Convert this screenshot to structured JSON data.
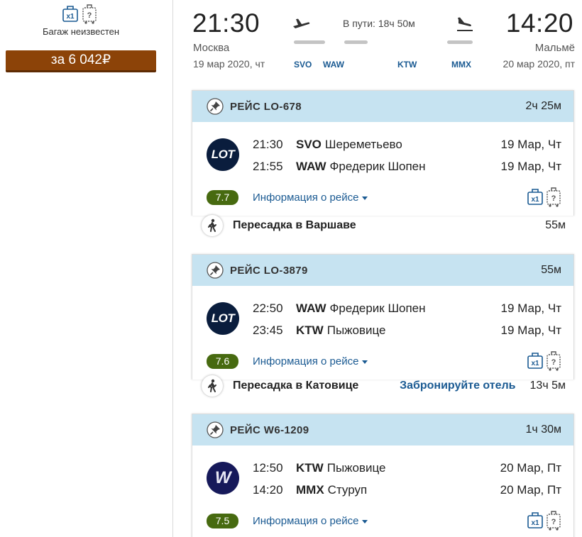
{
  "baggage": {
    "caption": "Багаж неизвестен",
    "hand_count": "x1",
    "checked_mark": "?"
  },
  "price": {
    "label": "за 6 042₽"
  },
  "summary": {
    "departure": {
      "time": "21:30",
      "city": "Москва",
      "date": "19 мар 2020, чт"
    },
    "arrival": {
      "time": "14:20",
      "city": "Мальмё",
      "date": "20 мар 2020, пт"
    },
    "duration": "В пути: 18ч 50м",
    "airports": [
      "SVO",
      "WAW",
      "KTW",
      "MMX"
    ]
  },
  "segments": [
    {
      "flight": "РЕЙС LO-678",
      "duration": "2ч 25м",
      "airline": "LOT",
      "rating": "7.7",
      "info_label": "Информация о рейсе",
      "dep": {
        "time": "21:30",
        "code": "SVO",
        "name": "Шереметьево",
        "date": "19 Мар, Чт"
      },
      "arr": {
        "time": "21:55",
        "code": "WAW",
        "name": "Фредерик Шопен",
        "date": "19 Мар, Чт"
      }
    },
    {
      "flight": "РЕЙС LO-3879",
      "duration": "55м",
      "airline": "LOT",
      "rating": "7.6",
      "info_label": "Информация о рейсе",
      "dep": {
        "time": "22:50",
        "code": "WAW",
        "name": "Фредерик Шопен",
        "date": "19 Мар, Чт"
      },
      "arr": {
        "time": "23:45",
        "code": "KTW",
        "name": "Пыжовице",
        "date": "19 Мар, Чт"
      }
    },
    {
      "flight": "РЕЙС W6-1209",
      "duration": "1ч 30м",
      "airline": "W",
      "rating": "7.5",
      "info_label": "Информация о рейсе",
      "dep": {
        "time": "12:50",
        "code": "KTW",
        "name": "Пыжовице",
        "date": "20 Мар, Пт"
      },
      "arr": {
        "time": "14:20",
        "code": "MMX",
        "name": "Стуруп",
        "date": "20 Мар, Пт"
      }
    }
  ],
  "transfers": [
    {
      "label": "Пересадка в Варшаве",
      "duration": "55м"
    },
    {
      "label": "Пересадка в Катовице",
      "hotel_link": "Забронируйте отель",
      "duration": "13ч 5м"
    }
  ],
  "colors": {
    "price_button": "#8c4308",
    "header_band": "#c6e3f1",
    "link": "#1a5a92",
    "rating": "#476a10",
    "logo_bg": "#0a1d3d"
  }
}
